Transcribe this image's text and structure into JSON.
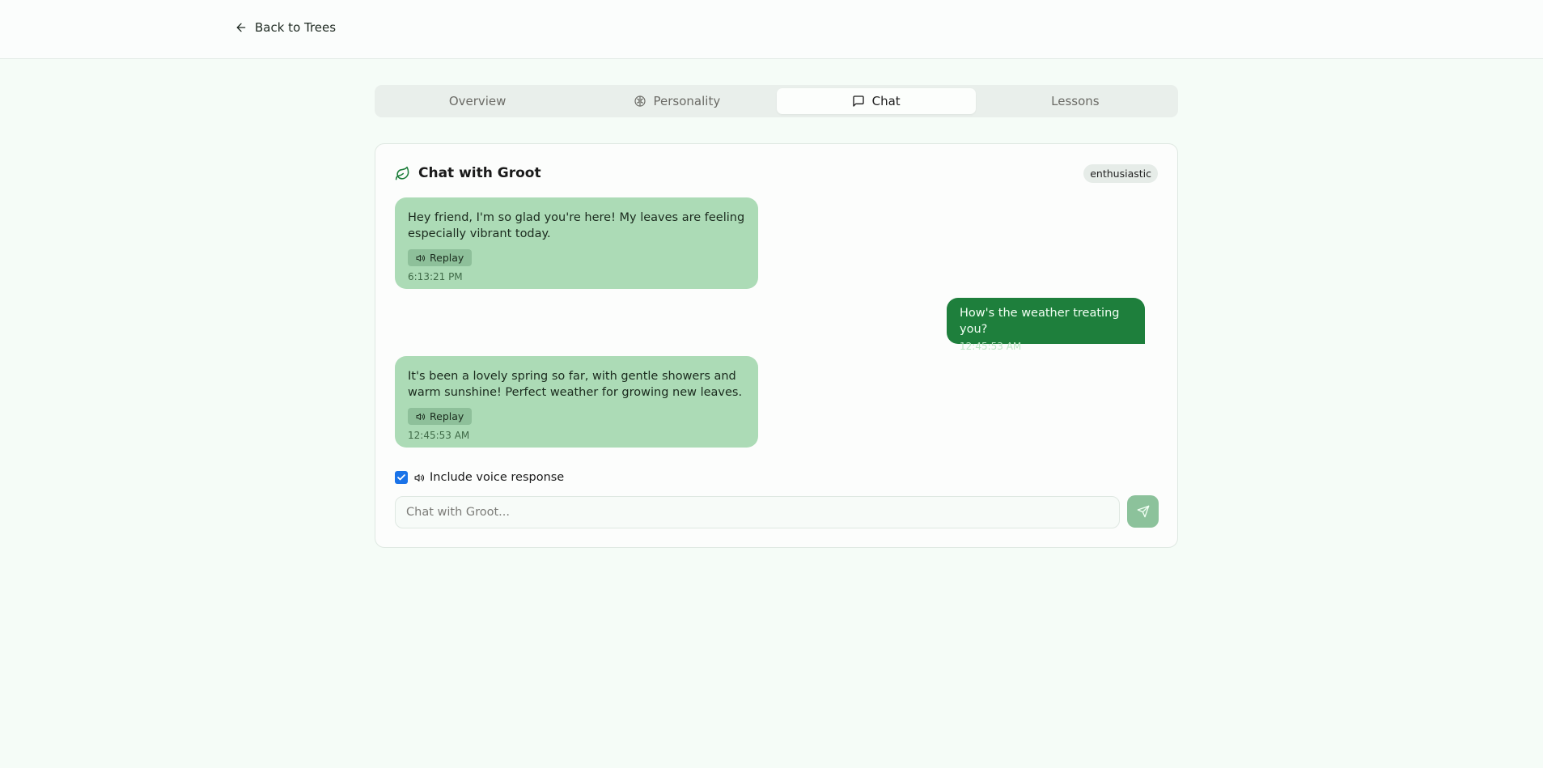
{
  "header": {
    "back_label": "Back to Trees"
  },
  "tabs": [
    {
      "label": "Overview",
      "icon": ""
    },
    {
      "label": "Personality",
      "icon": "brain-icon"
    },
    {
      "label": "Chat",
      "icon": "message-icon",
      "active": true
    },
    {
      "label": "Lessons",
      "icon": ""
    }
  ],
  "chat": {
    "title": "Chat with Groot",
    "title_icon": "leaf-icon",
    "mood": "enthusiastic",
    "messages": [
      {
        "role": "bot",
        "text": "Hey friend, I'm so glad you're here! My leaves are feeling especially vibrant today.",
        "replay_label": "Replay",
        "time": "6:13:21 PM"
      },
      {
        "role": "user",
        "text": "How's the weather treating you?",
        "time": "12:45:53 AM"
      },
      {
        "role": "bot",
        "text": "It's been a lovely spring so far, with gentle showers and warm sunshine! Perfect weather for growing new leaves.",
        "replay_label": "Replay",
        "time": "12:45:53 AM"
      }
    ],
    "voice_label": "Include voice response",
    "voice_checked": true,
    "input_placeholder": "Chat with Groot...",
    "input_value": ""
  },
  "colors": {
    "accent": "#1e7f3c",
    "bot_bubble": "#acdbb6",
    "send_button": "#8cc29b",
    "checkbox": "#1a73e8"
  }
}
